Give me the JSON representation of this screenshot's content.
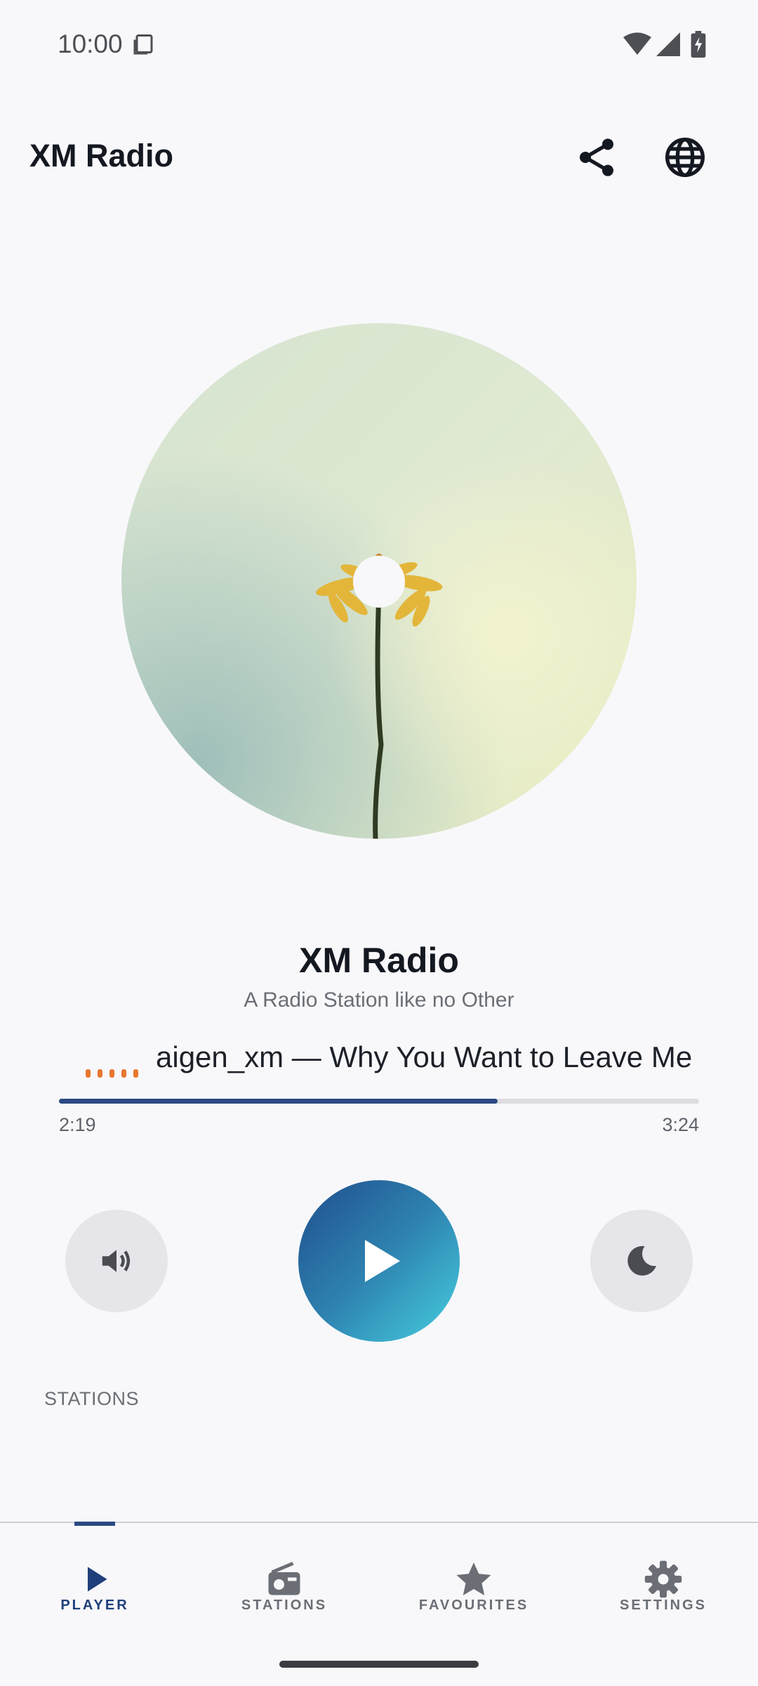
{
  "status_bar": {
    "time": "10:00",
    "icons": [
      "copy-icon",
      "wifi-icon",
      "signal-icon",
      "battery-charging-icon"
    ]
  },
  "app_bar": {
    "title": "XM Radio",
    "actions": [
      "share-icon",
      "globe-icon"
    ]
  },
  "now_playing": {
    "station_name": "XM Radio",
    "tagline": "A Radio Station like no Other",
    "track": "aigen_xm — Why You Want to Leave Me",
    "elapsed": "2:19",
    "total": "3:24",
    "progress": 0.685
  },
  "controls": {
    "left": "volume-icon",
    "center": "play-icon",
    "right": "sleep-moon-icon"
  },
  "stations_heading": "STATIONS",
  "bottom_nav": {
    "active": "player",
    "items": [
      {
        "label": "PLAYER",
        "icon": "play-icon"
      },
      {
        "label": "STATIONS",
        "icon": "radio-icon"
      },
      {
        "label": "FAVOURITES",
        "icon": "star-icon"
      },
      {
        "label": "SETTINGS",
        "icon": "gear-icon"
      }
    ]
  },
  "colors": {
    "accent": "#2a4a82",
    "play_gradient_start": "#1f4e8c",
    "play_gradient_end": "#46cfe0",
    "equalizer": "#e8772e"
  }
}
